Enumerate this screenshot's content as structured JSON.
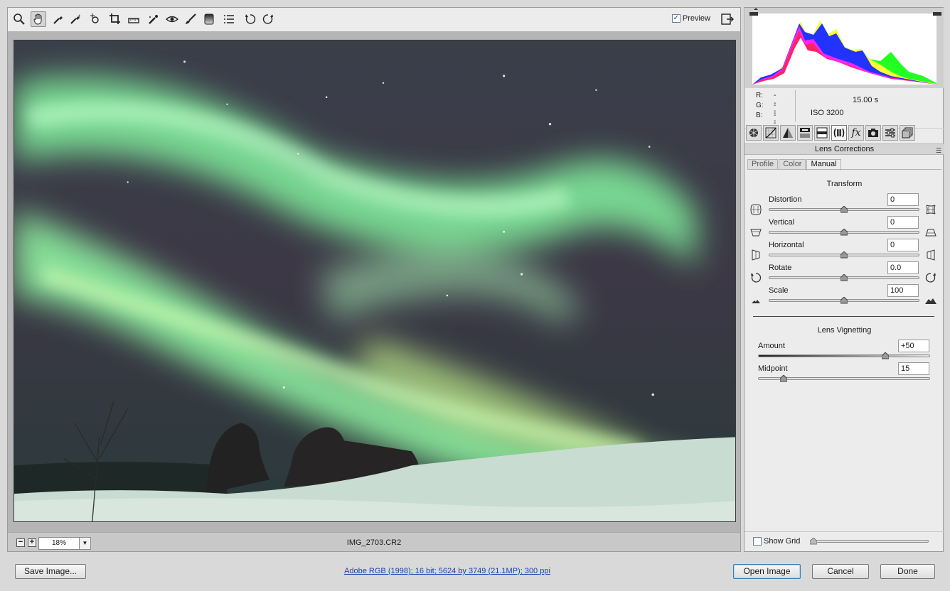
{
  "toolbar": {
    "tools": [
      "zoom-tool-icon",
      "hand-tool-icon",
      "white-balance-icon",
      "color-sampler-icon",
      "targeted-adjustment-icon",
      "crop-icon",
      "straighten-icon",
      "spot-removal-icon",
      "red-eye-icon",
      "adjustment-brush-icon",
      "graduated-filter-icon",
      "preferences-icon",
      "rotate-ccw-icon",
      "rotate-cw-icon"
    ],
    "preview_label": "Preview",
    "preview_checked": true,
    "preview_check_glyph": "✓"
  },
  "status": {
    "zoom_out_glyph": "−",
    "zoom_in_glyph": "+",
    "zoom_value": "18%",
    "zoom_drop_glyph": "▼",
    "filename": "IMG_2703.CR2"
  },
  "readout": {
    "r_label": "R:",
    "r_value": "---",
    "g_label": "G:",
    "g_value": "---",
    "b_label": "B:",
    "b_value": "---",
    "shutter": "15.00 s",
    "iso": "ISO 3200"
  },
  "panel": {
    "tabs": [
      "basic-icon",
      "tone-curve-icon",
      "detail-icon",
      "hsl-icon",
      "split-toning-icon",
      "lens-corrections-icon",
      "effects-icon",
      "camera-calibration-icon",
      "presets-icon",
      "snapshots-icon"
    ],
    "active_tab": "lens-corrections-icon",
    "effects_glyph": "fx",
    "section_title": "Lens Corrections",
    "section_menu_glyph": "☰",
    "subtabs": [
      "Profile",
      "Color",
      "Manual"
    ],
    "active_subtab": "Manual",
    "transform": {
      "title": "Transform",
      "distortion": {
        "label": "Distortion",
        "value": "0"
      },
      "vertical": {
        "label": "Vertical",
        "value": "0"
      },
      "horizontal": {
        "label": "Horizontal",
        "value": "0"
      },
      "rotate": {
        "label": "Rotate",
        "value": "0.0"
      },
      "scale": {
        "label": "Scale",
        "value": "100"
      }
    },
    "vignetting": {
      "title": "Lens Vignetting",
      "amount": {
        "label": "Amount",
        "value": "+50",
        "level": 0.75
      },
      "midpoint": {
        "label": "Midpoint",
        "value": "15",
        "level": 0.15
      }
    },
    "show_grid": {
      "label": "Show Grid",
      "checked": false
    }
  },
  "bottom": {
    "save_label": "Save Image...",
    "workflow_link": "Adobe RGB (1998); 16 bit; 5624 by 3749 (21.1MP); 300 ppi",
    "open_label": "Open Image",
    "cancel_label": "Cancel",
    "done_label": "Done"
  },
  "colors": {
    "accent_link": "#1d3fb3",
    "aurora_green": "#8ef0a0",
    "sky": "#2a2e3a"
  }
}
